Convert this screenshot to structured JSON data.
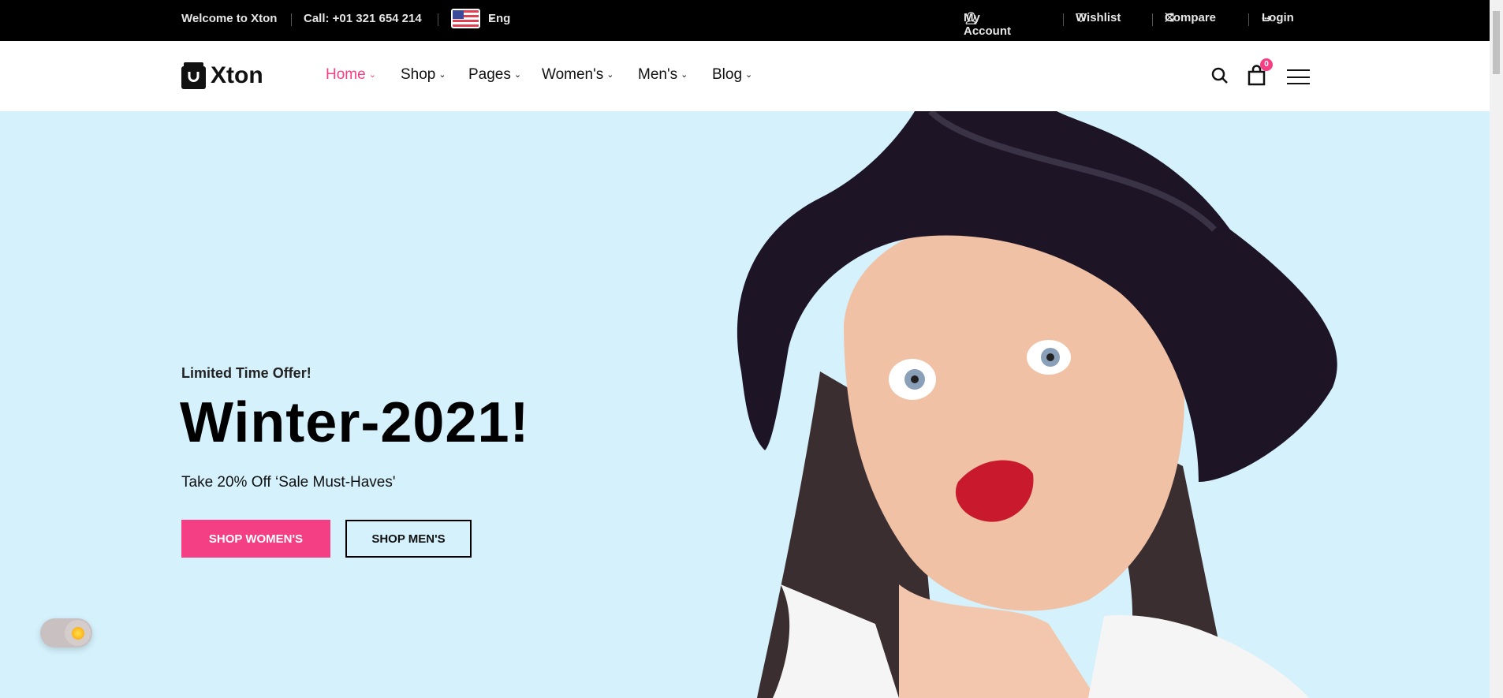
{
  "topbar": {
    "welcome": "Welcome to Xton",
    "call": "Call: +01 321 654 214",
    "language": "Eng",
    "account": "My Account",
    "wishlist": "Wishlist",
    "compare": "Compare",
    "login": "Login"
  },
  "header": {
    "logo": "Xton",
    "nav": [
      {
        "label": "Home",
        "active": true
      },
      {
        "label": "Shop"
      },
      {
        "label": "Pages"
      },
      {
        "label": "Women's"
      },
      {
        "label": "Men's"
      },
      {
        "label": "Blog"
      }
    ],
    "cart_count": "0"
  },
  "hero": {
    "eyebrow": "Limited Time Offer!",
    "title": "Winter-2021!",
    "subtitle": "Take 20% Off ‘Sale Must-Haves'",
    "primary_button": "SHOP WOMEN'S",
    "secondary_button": "SHOP MEN'S"
  },
  "colors": {
    "accent": "#f53f85",
    "hero_bg": "#d4f1fc",
    "topbar_bg": "#000000"
  },
  "theme_toggle": {
    "state": "light",
    "icon": "sun-icon"
  }
}
